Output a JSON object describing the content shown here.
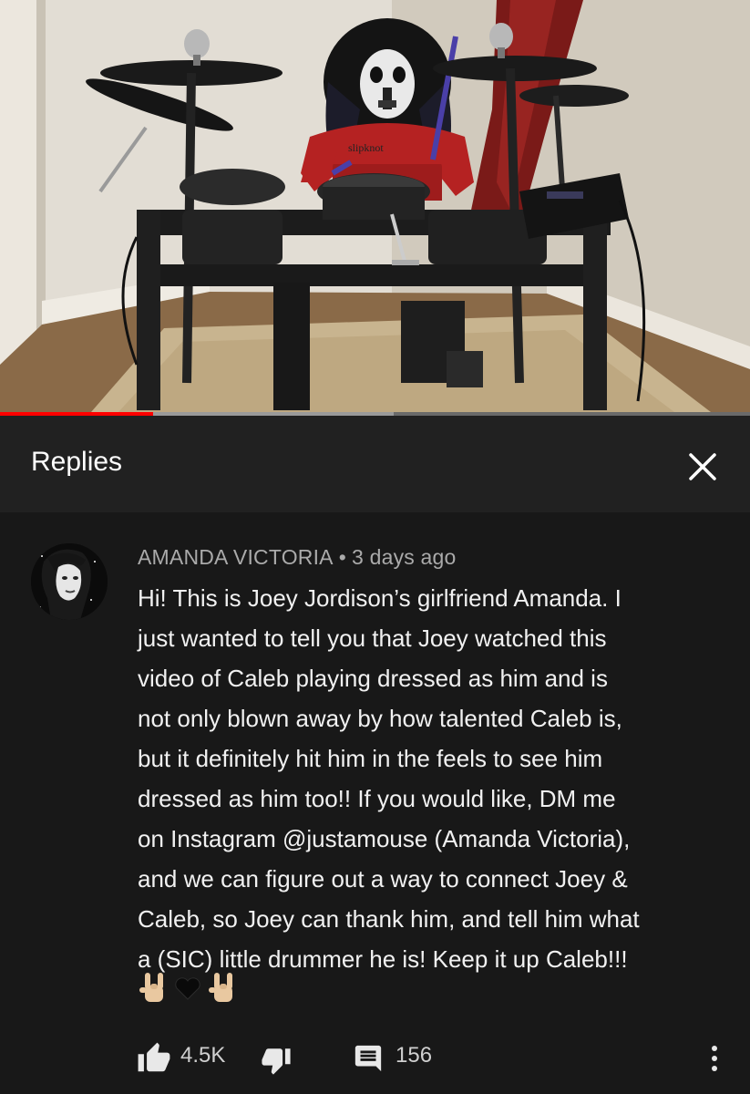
{
  "video": {
    "shirt_text": "slipknot",
    "progress_fraction": 0.204,
    "buffer_fraction": 0.525
  },
  "replies_panel": {
    "title": "Replies",
    "close_icon": "close-icon"
  },
  "comment": {
    "author": "AMANDA VICTORIA",
    "separator": "•",
    "time": "3 days ago",
    "lines": [
      "Hi! This is Joey Jordison’s girlfriend Amanda. I",
      "just wanted to tell you that Joey watched this",
      "video of Caleb playing dressed as him and is",
      "not only blown away by how talented Caleb is,",
      "but it definitely hit him in the feels to see him",
      "dressed as him too!! If you would like, DM me",
      "on Instagram @justamouse (Amanda Victoria),",
      "and we can figure out a way to connect Joey &",
      "Caleb, so Joey can thank him, and tell him what",
      "a (SIC) little drummer he is! Keep it up Caleb!!!"
    ],
    "emojis": [
      "sign-of-the-horns",
      "black-heart",
      "sign-of-the-horns"
    ],
    "likes": "4.5K",
    "replies": "156"
  },
  "icons": {
    "like": "thumbs-up-icon",
    "dislike": "thumbs-down-icon",
    "reply": "comment-icon",
    "more": "more-vertical-icon"
  },
  "colors": {
    "background": "#181818",
    "header_background": "#212121",
    "progress_played": "#ff0000",
    "meta_text": "#aaaaaa"
  }
}
